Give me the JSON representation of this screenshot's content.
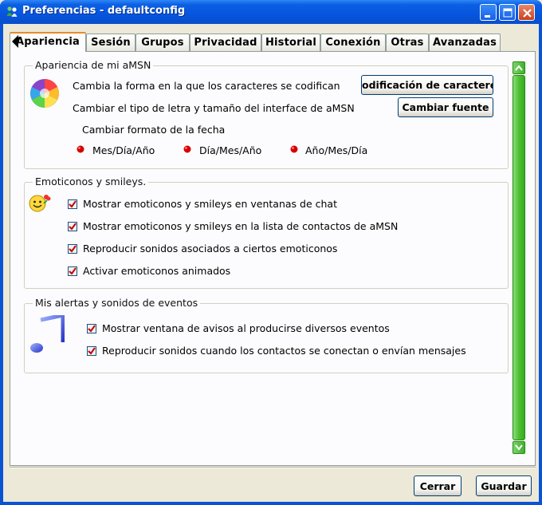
{
  "window": {
    "title": "Preferencias - defaultconfig"
  },
  "tabs": [
    {
      "label": "Apariencia",
      "active": true
    },
    {
      "label": "Sesión"
    },
    {
      "label": "Grupos"
    },
    {
      "label": "Privacidad"
    },
    {
      "label": "Historial"
    },
    {
      "label": "Conexión"
    },
    {
      "label": "Otras"
    },
    {
      "label": "Avanzadas"
    }
  ],
  "appearance": {
    "legend": "Apariencia de mi aMSN",
    "encoding_text": "Cambia la forma en la que los caracteres se codifican",
    "encoding_button": "odificación de caractere",
    "font_text": "Cambiar el tipo de letra y tamaño del interface de aMSN",
    "font_button": "Cambiar fuente",
    "date_text": "Cambiar formato de la fecha",
    "date_options": [
      {
        "label": "Mes/Día/Año",
        "selected": true
      },
      {
        "label": "Día/Mes/Año",
        "selected": true
      },
      {
        "label": "Año/Mes/Día",
        "selected": true
      }
    ]
  },
  "emoticons": {
    "legend": "Emoticonos y smileys.",
    "options": [
      {
        "label": "Mostrar emoticonos y smileys en ventanas de chat",
        "checked": true
      },
      {
        "label": "Mostrar emoticonos y smileys en la lista de contactos de aMSN",
        "checked": true
      },
      {
        "label": "Reproducir sonidos asociados a ciertos emoticonos",
        "checked": true
      },
      {
        "label": "Activar emoticonos animados",
        "checked": true
      }
    ]
  },
  "alerts": {
    "legend": "Mis alertas y sonidos de eventos",
    "options": [
      {
        "label": "Mostrar ventana de avisos al producirse diversos eventos",
        "checked": true
      },
      {
        "label": "Reproducir sonidos cuando los contactos se conectan o envían mensajes",
        "checked": true
      }
    ]
  },
  "footer": {
    "cancel": "Cerrar",
    "save": "Guardar"
  },
  "colors": {
    "radio_dot": "#d40000",
    "check_mark": "#c00000",
    "scrollbar": "#4cc132",
    "title_bar": "#0655df"
  }
}
